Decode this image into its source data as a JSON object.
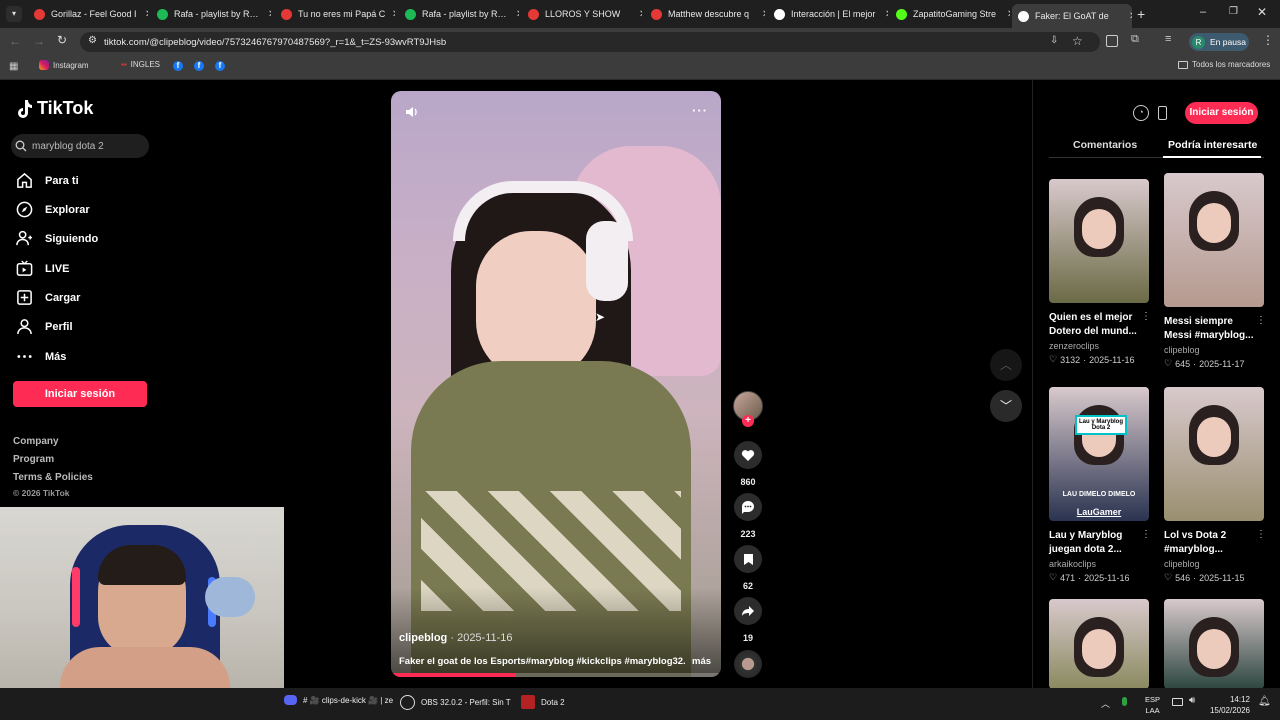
{
  "browser": {
    "tabs": [
      {
        "title": "Gorillaz - Feel Good I",
        "color": "#e53935"
      },
      {
        "title": "Rafa - playlist by Rafa",
        "color": "#1db954"
      },
      {
        "title": "Tu no eres mi Papá C",
        "color": "#e53935"
      },
      {
        "title": "Rafa - playlist by Rafa",
        "color": "#1db954"
      },
      {
        "title": "LLOROS Y SHOW",
        "color": "#e53935"
      },
      {
        "title": "Matthew descubre q",
        "color": "#e53935"
      },
      {
        "title": "Interacción | El mejor",
        "color": "#ffffff"
      },
      {
        "title": "ZapatitoGaming Stre",
        "color": "#53fc18"
      },
      {
        "title": "Faker: El GoAT de",
        "color": "#ffffff"
      }
    ],
    "url": "tiktok.com/@clipeblog/video/7573246767970487569?_r=1&_t=ZS-93wvRT9JHsb",
    "profile_status": "En pausa",
    "profile_initial": "R",
    "bookmarks": [
      {
        "label": "Instagram",
        "icon": "instagram-icon"
      },
      {
        "label": "INGLES",
        "icon": "folder-icon"
      }
    ],
    "all_bookmarks": "Todos los marcadores"
  },
  "tiktok": {
    "logo": "TikTok",
    "search_value": "maryblog dota 2",
    "nav": [
      {
        "label": "Para ti",
        "icon": "home-icon"
      },
      {
        "label": "Explorar",
        "icon": "compass-icon"
      },
      {
        "label": "Siguiendo",
        "icon": "following-icon"
      },
      {
        "label": "LIVE",
        "icon": "live-icon"
      },
      {
        "label": "Cargar",
        "icon": "upload-icon"
      },
      {
        "label": "Perfil",
        "icon": "profile-icon"
      },
      {
        "label": "Más",
        "icon": "more-icon"
      }
    ],
    "login_label": "Iniciar sesión",
    "footer_links": [
      "Company",
      "Program",
      "Terms & Policies"
    ],
    "copyright": "© 2026 TikTok"
  },
  "video": {
    "author": "clipeblog",
    "date": "2025-11-16",
    "caption": "Faker el goat de los Esports#maryblog #kickclips #maryblog32...",
    "more_label": "más",
    "likes": "860",
    "comments": "223",
    "saves": "62",
    "shares": "19",
    "progress": 0.38
  },
  "right_panel": {
    "login_label": "Iniciar sesión",
    "tabs": [
      "Comentarios",
      "Podría interesarte"
    ],
    "active_tab": 1,
    "cards": [
      {
        "title": "Quien es el mejor Dotero del mund...",
        "author": "zenzeroclips",
        "likes": "3132",
        "date": "2025-11-16",
        "theme": "#6b6a45"
      },
      {
        "title": "Messi siempre Messi #maryblog...",
        "author": "clipeblog",
        "likes": "645",
        "date": "2025-11-17",
        "theme": "#b59a8f"
      },
      {
        "title": "Lau y Maryblog juegan dota 2...",
        "author": "arkaikoclips",
        "likes": "471",
        "date": "2025-11-16",
        "theme": "#2a3350",
        "overlay_top": "Lau y Maryblog Dota 2",
        "overlay_mid": "LAU DIMELO DIMELO",
        "overlay_name": "LauGamer"
      },
      {
        "title": "Lol vs Dota 2 #maryblog...",
        "author": "clipeblog",
        "likes": "546",
        "date": "2025-11-15",
        "theme": "#9a8f70"
      },
      {
        "title": "",
        "author": "",
        "likes": "",
        "date": "",
        "theme": "#8a8a60"
      },
      {
        "title": "",
        "author": "",
        "likes": "",
        "date": "",
        "theme": "#2c4640"
      }
    ]
  },
  "taskbar": {
    "items": [
      {
        "label": "# 🎥 clips-de-kick 🎥 | ze",
        "icon": "discord-icon"
      },
      {
        "label": "OBS 32.0.2 - Perfil: Sin T",
        "icon": "obs-icon"
      },
      {
        "label": "Dota 2",
        "icon": "dota-icon"
      }
    ],
    "lang_top": "ESP",
    "lang_bottom": "LAA",
    "time": "14:12",
    "date": "15/02/2026"
  }
}
